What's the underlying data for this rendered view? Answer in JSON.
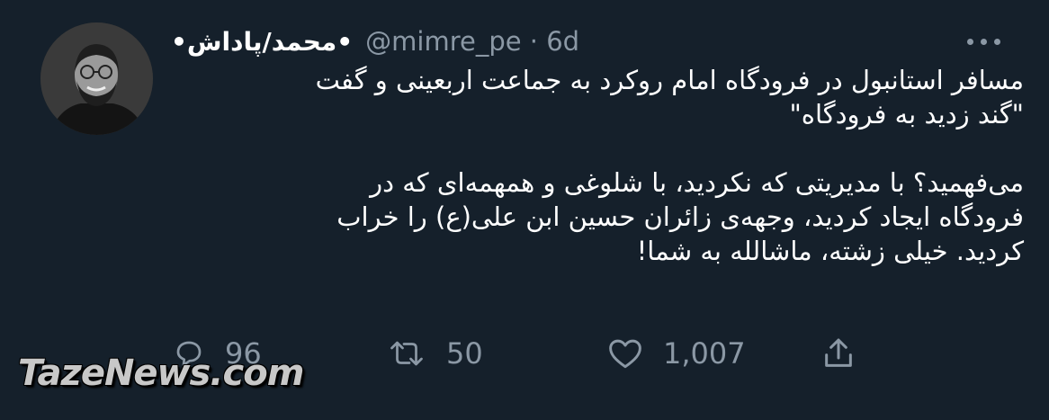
{
  "tweet": {
    "author_name": "•محمد/پاداش•",
    "handle_time": "@mimre_pe · 6d",
    "body_lines_1": [
      "مسافر استانبول در فرودگاه امام روکرد به جماعت اربعینی و گفت",
      "\"گند زدید به فرودگاه\""
    ],
    "body_lines_2": [
      "می‌فهمید؟ با مدیریتی که نکردید، با شلوغی و همهمه‌ای که در",
      "فرودگاه ایجاد کردید، وجهه‌ی زائران حسین ابن علی(ع) را خراب",
      "کردید. خیلی زشته، ماشالله به شما!"
    ]
  },
  "actions": {
    "replies": "96",
    "retweets": "50",
    "likes": "1,007"
  },
  "icons": {
    "more": "more-dots-icon",
    "reply": "reply-icon",
    "retweet": "retweet-icon",
    "like": "heart-icon",
    "share": "share-icon"
  },
  "watermark": "TazeNews.com",
  "colors": {
    "background": "#15202b",
    "text": "#ffffff",
    "secondary": "#8b98a5"
  }
}
